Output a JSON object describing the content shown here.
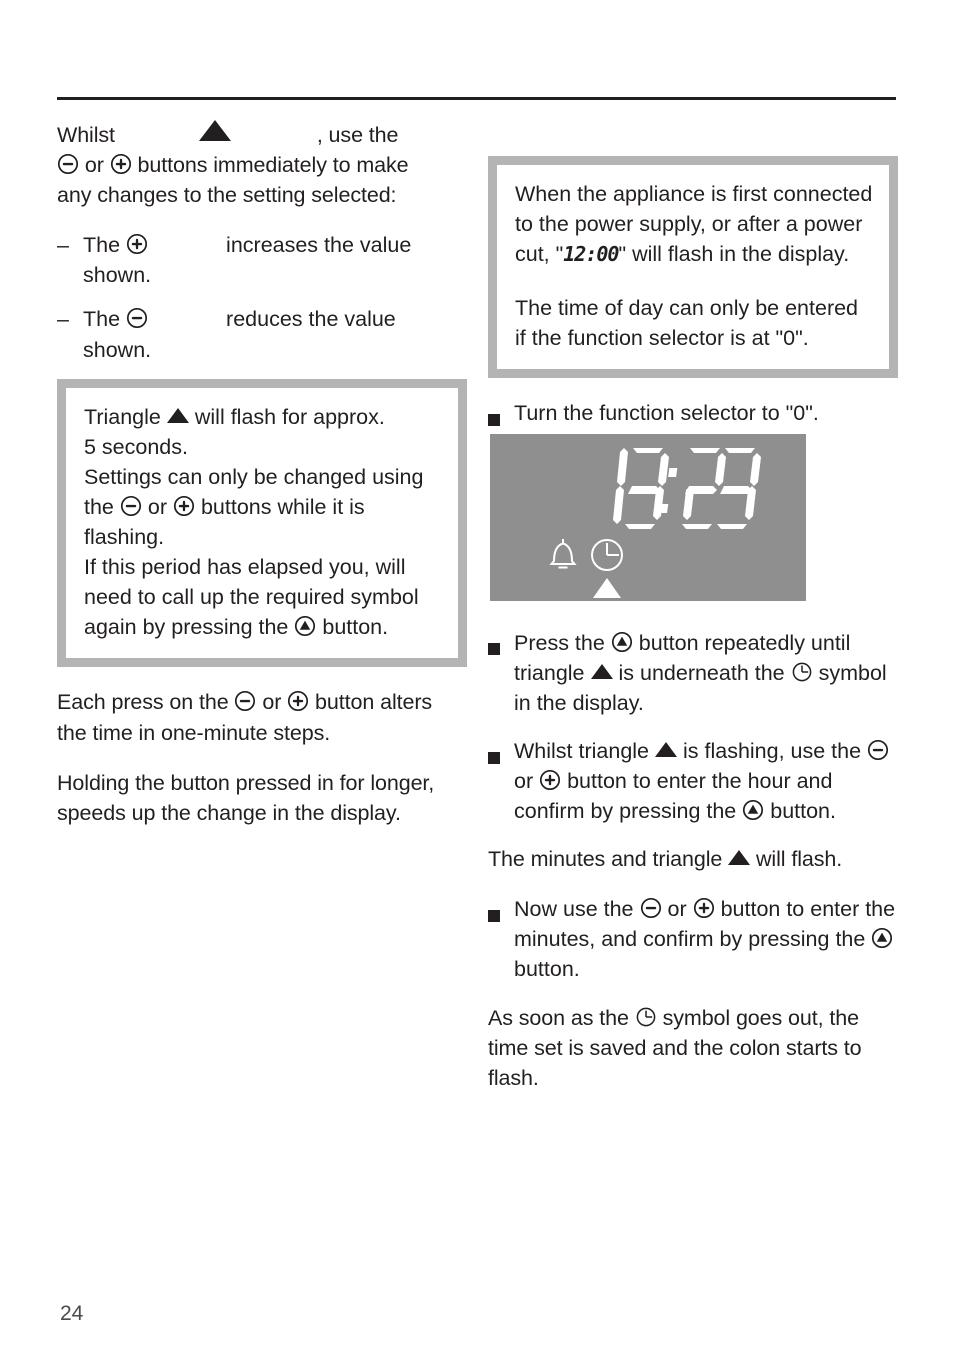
{
  "page": {
    "number": "24",
    "has_header_rule": true
  },
  "symbols": {
    "minus_button": "circled-minus",
    "plus_button": "circled-plus",
    "select_button": "circled-triangle-up",
    "triangle": "filled-triangle-up",
    "clock": "clock-symbol",
    "bell": "bell-symbol"
  },
  "colors": {
    "text": "#231f20",
    "note_border": "#b4b4b4",
    "lcd_background": "#8f8f8f",
    "lcd_foreground": "#ffffff"
  },
  "left_column": {
    "intro": {
      "part1": "Whilst",
      "part2": ", use the",
      "line2_a": "or",
      "line2_b": "buttons immediately to make",
      "line3": "any changes to the setting selected:"
    },
    "dash_items": [
      {
        "marker": "–",
        "text_before": "The",
        "text_after": "increases the value",
        "text_line2": "shown.",
        "symbol": "circled-plus"
      },
      {
        "marker": "–",
        "text_before": "The",
        "text_after": "reduces the value",
        "text_line2": "shown.",
        "symbol": "circled-minus"
      }
    ],
    "note_box": {
      "seg1_before": "Triangle",
      "seg1_after": "will flash for approx.",
      "line2": "5 seconds.",
      "line3": "Settings can only be changed using",
      "line4_a": "the",
      "line4_b": "or",
      "line4_c": "buttons while it is",
      "line5": "flashing.",
      "line6": "If this period has elapsed you, will",
      "line7": "need to call up the required symbol",
      "line8_a": "again by pressing the",
      "line8_b": "button."
    },
    "paragraphs": [
      {
        "a": "Each press on the",
        "b": "or",
        "c": "button alters the time in one-minute steps."
      },
      {
        "text": "Holding the button pressed in for longer, speeds up the change in the display."
      }
    ]
  },
  "right_column": {
    "note_box": {
      "p1_a": "When the appliance is first connected to the power supply, or after a power cut, \"",
      "p1_seg": "12:00",
      "p1_b": "\" will flash in the display.",
      "p2": "The time of day can only be entered if the function selector is at \"0\"."
    },
    "bullets": [
      {
        "text": "Turn the function selector to \"0\"."
      },
      {
        "a": "Press the",
        "b": "button repeatedly until triangle",
        "c": "is underneath the",
        "d": "symbol in the display."
      },
      {
        "a": "Whilst triangle",
        "b": "is flashing, use the",
        "c": "or",
        "d": "button to enter the hour and confirm by pressing the",
        "e": "button."
      },
      {
        "a": "Now use the",
        "b": "or",
        "c": "button to enter the minutes, and confirm by pressing the",
        "d": "button."
      }
    ],
    "para_minutes": {
      "a": "The minutes and triangle",
      "b": "will flash."
    },
    "para_saved": {
      "a": "As soon as the",
      "b": "symbol goes out, the time set is saved and the colon starts to flash."
    }
  },
  "lcd": {
    "time": "13:23",
    "hours": "13",
    "minutes": "23",
    "colon": ":",
    "icons": [
      "bell-symbol",
      "clock-symbol"
    ],
    "indicator": "filled-triangle-up",
    "indicator_under": "clock-symbol"
  }
}
